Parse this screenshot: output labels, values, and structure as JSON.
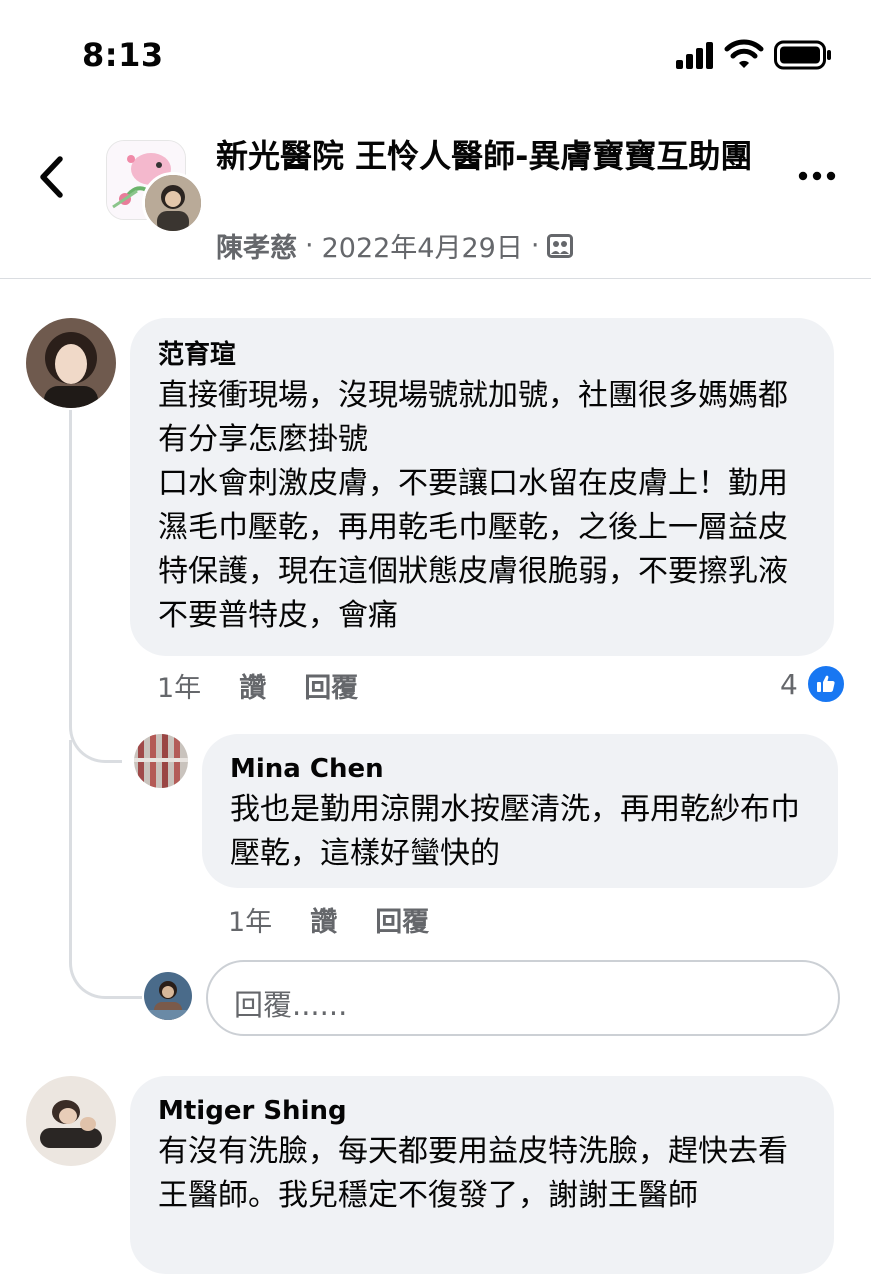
{
  "status_bar": {
    "time": "8:13"
  },
  "header": {
    "group_name": "新光醫院 王怜人醫師-異膚寶寶互助團",
    "author": "陳孝慈",
    "date": "2022年4月29日",
    "separator": "·"
  },
  "comments": [
    {
      "name": "范育瑄",
      "text": "直接衝現場，沒現場號就加號，社團很多媽媽都有分享怎麼掛號\n口水會刺激皮膚，不要讓口水留在皮膚上！勤用濕毛巾壓乾，再用乾毛巾壓乾，之後上一層益皮特保護，現在這個狀態皮膚很脆弱，不要擦乳液不要普特皮，會痛",
      "time": "1年",
      "like_label": "讚",
      "reply_label": "回覆",
      "like_count": "4"
    },
    {
      "name": "Mina Chen",
      "text": "我也是勤用涼開水按壓清洗，再用乾紗布巾壓乾，這樣好蠻快的",
      "time": "1年",
      "like_label": "讚",
      "reply_label": "回覆"
    },
    {
      "name": "Mtiger Shing",
      "text": "有沒有洗臉，每天都要用益皮特洗臉，趕快去看王醫師。我兒穩定不復發了，謝謝王醫師"
    }
  ],
  "reply_input": {
    "placeholder": "回覆......"
  },
  "colors": {
    "accent": "#1877f2",
    "bubble": "#f0f2f5",
    "muted": "#65676b"
  },
  "icons": [
    "signal-icon",
    "wifi-icon",
    "battery-icon",
    "back-chevron-icon",
    "more-icon",
    "group-icon",
    "thumbs-up-icon"
  ]
}
